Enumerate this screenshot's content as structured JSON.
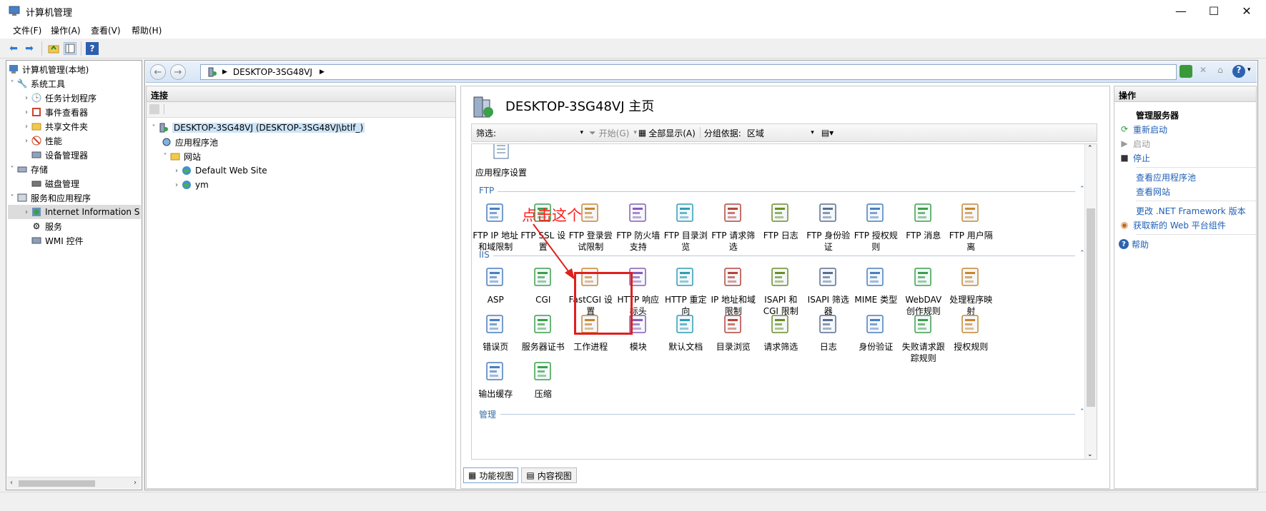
{
  "window": {
    "title": "计算机管理",
    "controls": {
      "minimize": "—",
      "maximize": "☐",
      "close": "✕"
    }
  },
  "menu": [
    "文件(F)",
    "操作(A)",
    "查看(V)",
    "帮助(H)"
  ],
  "tree": {
    "root": "计算机管理(本地)",
    "items": [
      {
        "label": "系统工具",
        "icon": "tools-icon"
      },
      {
        "label": "任务计划程序",
        "icon": "clock-icon"
      },
      {
        "label": "事件查看器",
        "icon": "event-icon"
      },
      {
        "label": "共享文件夹",
        "icon": "folder-icon"
      },
      {
        "label": "性能",
        "icon": "perf-icon"
      },
      {
        "label": "设备管理器",
        "icon": "device-icon"
      },
      {
        "label": "存储",
        "icon": "storage-icon"
      },
      {
        "label": "磁盘管理",
        "icon": "disk-icon"
      },
      {
        "label": "服务和应用程序",
        "icon": "services-apps-icon"
      },
      {
        "label": "Internet Information S",
        "icon": "iis-icon"
      },
      {
        "label": "服务",
        "icon": "gear-icon"
      },
      {
        "label": "WMI 控件",
        "icon": "wmi-icon"
      }
    ]
  },
  "address": {
    "path": "DESKTOP-3SG48VJ"
  },
  "connections": {
    "header": "连接",
    "server": "DESKTOP-3SG48VJ (DESKTOP-3SG48VJ\\btlf_)",
    "apppools": "应用程序池",
    "sites": "网站",
    "site1": "Default Web Site",
    "site2": "ym"
  },
  "center": {
    "title": "DESKTOP-3SG48VJ 主页",
    "filter_label": "筛选:",
    "start_label": "开始(G)",
    "showall_label": "全部显示(A)",
    "groupby_label": "分组依据:",
    "groupby_value": "区域",
    "top_item": "应用程序设置",
    "groups": {
      "ftp": "FTP",
      "iis": "IIS",
      "mgmt": "管理"
    },
    "ftp_items": [
      "FTP IP 地址和域限制",
      "FTP SSL 设置",
      "FTP 登录尝试限制",
      "FTP 防火墙支持",
      "FTP 目录浏览",
      "FTP 请求筛选",
      "FTP 日志",
      "FTP 身份验证",
      "FTP 授权规则",
      "FTP 消息",
      "FTP 用户隔离"
    ],
    "iis_row1": [
      "ASP",
      "CGI",
      "FastCGI 设置",
      "HTTP 响应标头",
      "HTTP 重定向",
      "IP 地址和域限制",
      "ISAPI 和 CGI 限制",
      "ISAPI 筛选器",
      "MIME 类型",
      "WebDAV 创作规则",
      "处理程序映射"
    ],
    "iis_row2": [
      "错误页",
      "服务器证书",
      "工作进程",
      "模块",
      "默认文档",
      "目录浏览",
      "请求筛选",
      "日志",
      "身份验证",
      "失败请求跟踪规则",
      "授权规则"
    ],
    "iis_row3": [
      "输出缓存",
      "压缩"
    ],
    "annotation": "点击这个",
    "tabs": {
      "features": "功能视图",
      "content": "内容视图"
    }
  },
  "actions": {
    "header": "操作",
    "section": "管理服务器",
    "restart": "重新启动",
    "start": "启动",
    "stop": "停止",
    "view_apppools": "查看应用程序池",
    "view_sites": "查看网站",
    "change_net": "更改 .NET Framework 版本",
    "get_components": "获取新的 Web 平台组件",
    "help": "帮助"
  }
}
